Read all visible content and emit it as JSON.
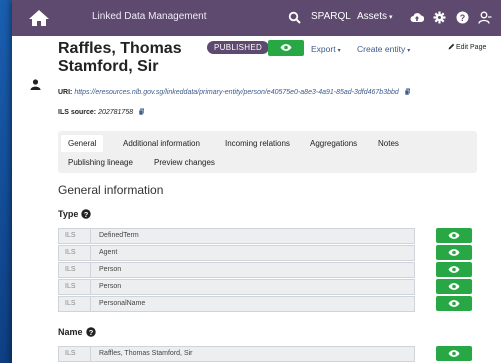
{
  "nav": {
    "app_title": "Linked Data Management",
    "sparql": "SPARQL",
    "assets": "Assets",
    "caret": "▾"
  },
  "entity": {
    "title": "Raffles, Thomas Stamford, Sir",
    "status": "PUBLISHED",
    "export_label": "Export",
    "create_label": "Create entity",
    "edit_label": "Edit Page",
    "uri_label": "URI:",
    "uri_value": "https://eresources.nlb.gov.sg/linkeddata/primary-entity/person/e40575e0-a8e3-4a91-85ad-3dfd467b3bbd",
    "ils_label": "ILS source:",
    "ils_value": "202781758"
  },
  "tabs": [
    {
      "label": "General",
      "active": true
    },
    {
      "label": "Additional information"
    },
    {
      "label": "Incoming relations"
    },
    {
      "label": "Aggregations"
    },
    {
      "label": "Notes"
    },
    {
      "label": "Publishing lineage"
    },
    {
      "label": "Preview changes"
    }
  ],
  "general": {
    "section_title": "General information",
    "type_label": "Type",
    "name_label": "Name",
    "types": [
      {
        "lang": "ILS",
        "value": "DefinedTerm"
      },
      {
        "lang": "ILS",
        "value": "Agent"
      },
      {
        "lang": "ILS",
        "value": "Person"
      },
      {
        "lang": "ILS",
        "value": "Person"
      },
      {
        "lang": "ILS",
        "value": "PersonalName"
      }
    ],
    "names": [
      {
        "lang": "ILS",
        "value": "Raffles, Thomas Stamford, Sir"
      }
    ]
  },
  "colors": {
    "navbar": "#5d4a6e",
    "success": "#28a745",
    "link": "#3d5b8c"
  },
  "icons": [
    "home-icon",
    "search-icon",
    "cloud-upload-icon",
    "gear-icon",
    "help-icon",
    "user-icon",
    "person-icon",
    "eye-icon",
    "pencil-icon",
    "copy-icon"
  ]
}
